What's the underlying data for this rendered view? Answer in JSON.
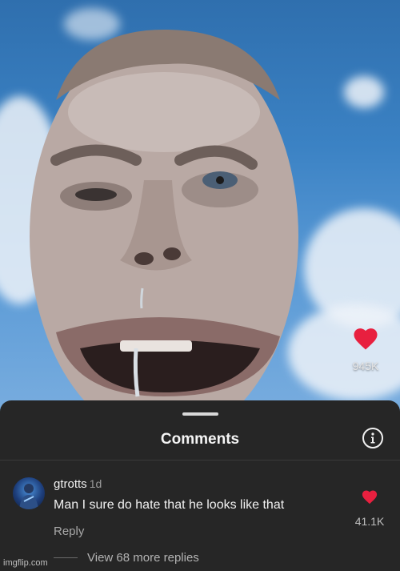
{
  "video": {
    "likes_count": "945K"
  },
  "comments_sheet": {
    "title": "Comments",
    "comment": {
      "username": "gtrotts",
      "timestamp": "1d",
      "text": "Man I sure do hate that he looks like that",
      "reply_label": "Reply",
      "likes_count": "41.1K"
    },
    "view_more_replies": "View 68 more replies"
  },
  "watermark": "imgflip.com",
  "colors": {
    "heart": "#e8203f",
    "sheet_bg": "#262626",
    "sky": "#3b82c4"
  },
  "icons": [
    "heart-icon",
    "info-icon"
  ]
}
